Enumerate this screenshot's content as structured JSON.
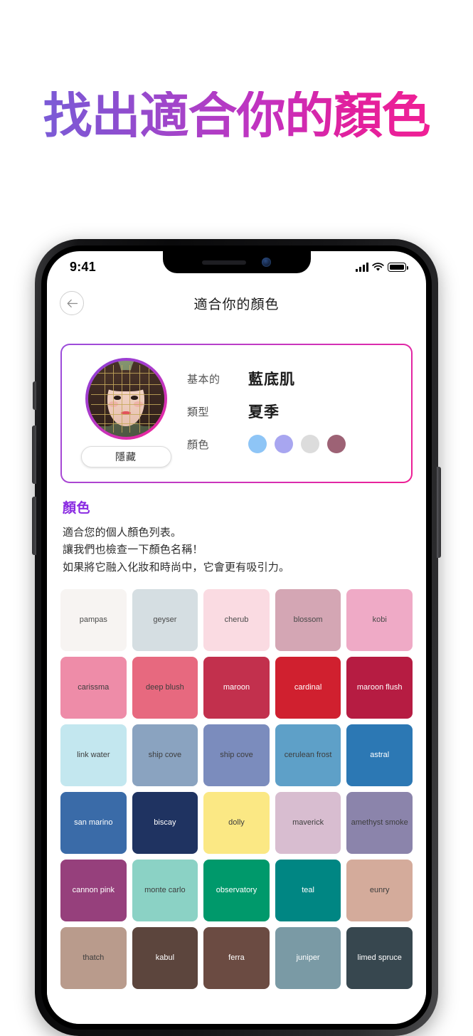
{
  "headline": "找出適合你的顏色",
  "statusbar": {
    "time": "9:41",
    "signal_bars": 4,
    "wifi": "wifi-icon",
    "battery": "battery-full-icon"
  },
  "header": {
    "title": "適合你的顏色",
    "back_icon": "arrow-left-icon"
  },
  "profile": {
    "hide_button": "隱藏",
    "rows": [
      {
        "label": "基本的",
        "value": "藍底肌"
      },
      {
        "label": "類型",
        "value": "夏季"
      }
    ],
    "colors_label": "顏色",
    "dots": [
      "#8ec5f6",
      "#a8a6f0",
      "#dcdcdc",
      "#9d6275"
    ]
  },
  "section": {
    "title": "顏色",
    "desc_line1": "適合您的個人顏色列表。",
    "desc_line2": "讓我們也檢查一下顏色名稱！",
    "desc_line3": "如果將它融入化妝和時尚中，它會更有吸引力。"
  },
  "swatches": [
    {
      "name": "pampas",
      "hex": "#f7f4f2",
      "text": "#4a4a4a"
    },
    {
      "name": "geyser",
      "hex": "#d5dee2",
      "text": "#4a4a4a"
    },
    {
      "name": "cherub",
      "hex": "#fadbe2",
      "text": "#4a4a4a"
    },
    {
      "name": "blossom",
      "hex": "#d4a6b4",
      "text": "#4a4a4a"
    },
    {
      "name": "kobi",
      "hex": "#efaac6",
      "text": "#4a4a4a"
    },
    {
      "name": "carissma",
      "hex": "#ee8ca8",
      "text": "#3d3d3d"
    },
    {
      "name": "deep blush",
      "hex": "#e7697f",
      "text": "#3d3d3d"
    },
    {
      "name": "maroon",
      "hex": "#c2304d",
      "text": "#ffffff"
    },
    {
      "name": "cardinal",
      "hex": "#d0202f",
      "text": "#ffffff"
    },
    {
      "name": "maroon flush",
      "hex": "#b61c42",
      "text": "#ffffff"
    },
    {
      "name": "link water",
      "hex": "#c3e7ef",
      "text": "#3d3d3d"
    },
    {
      "name": "ship cove",
      "hex": "#8aa3c0",
      "text": "#3d3d3d"
    },
    {
      "name": "ship cove",
      "hex": "#7b8cbd",
      "text": "#3d3d3d"
    },
    {
      "name": "cerulean frost",
      "hex": "#5ea0c8",
      "text": "#3d3d3d"
    },
    {
      "name": "astral",
      "hex": "#2c78b4",
      "text": "#ffffff"
    },
    {
      "name": "san marino",
      "hex": "#3a6ba8",
      "text": "#ffffff"
    },
    {
      "name": "biscay",
      "hex": "#1f3361",
      "text": "#ffffff"
    },
    {
      "name": "dolly",
      "hex": "#fbe884",
      "text": "#3d3d3d"
    },
    {
      "name": "maverick",
      "hex": "#d8bdd0",
      "text": "#3d3d3d"
    },
    {
      "name": "amethyst smoke",
      "hex": "#8b84ab",
      "text": "#3d3d3d"
    },
    {
      "name": "cannon pink",
      "hex": "#96407c",
      "text": "#ffffff"
    },
    {
      "name": "monte carlo",
      "hex": "#8bd2c5",
      "text": "#3d3d3d"
    },
    {
      "name": "observatory",
      "hex": "#00996b",
      "text": "#ffffff"
    },
    {
      "name": "teal",
      "hex": "#008683",
      "text": "#ffffff"
    },
    {
      "name": "eunry",
      "hex": "#d4ab9b",
      "text": "#3d3d3d"
    },
    {
      "name": "thatch",
      "hex": "#b99b8c",
      "text": "#3d3d3d"
    },
    {
      "name": "kabul",
      "hex": "#5c453d",
      "text": "#ffffff"
    },
    {
      "name": "ferra",
      "hex": "#6b4b42",
      "text": "#ffffff"
    },
    {
      "name": "juniper",
      "hex": "#7a9aa5",
      "text": "#ffffff"
    },
    {
      "name": "limed spruce",
      "hex": "#37474f",
      "text": "#ffffff"
    }
  ]
}
